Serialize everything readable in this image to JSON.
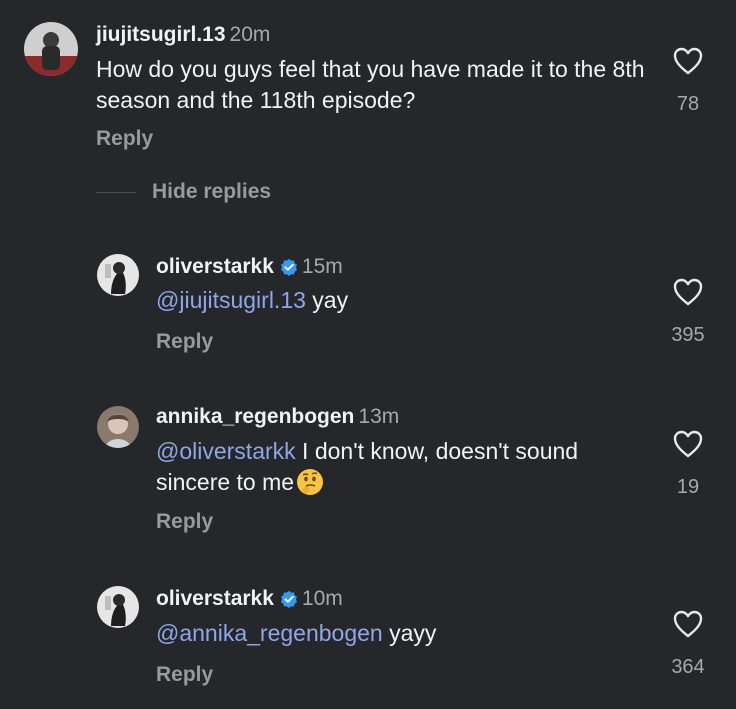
{
  "comments": [
    {
      "username": "jiujitsugirl.13",
      "time": "20m",
      "text": "How do you guys feel that you  have made it to the 8th season and the 118th episode?",
      "reply_label": "Reply",
      "likes": "78"
    }
  ],
  "hide_replies_label": "Hide replies",
  "replies": [
    {
      "username": "oliverstarkk",
      "verified": true,
      "time": "15m",
      "mention": "@jiujitsugirl.13",
      "text": " yay",
      "reply_label": "Reply",
      "likes": "395"
    },
    {
      "username": "annika_regenbogen",
      "verified": false,
      "time": "13m",
      "mention": "@oliverstarkk",
      "text": " I don't know, doesn't sound sincere to me",
      "emoji": "thinking-face-emoji",
      "reply_label": "Reply",
      "likes": "19"
    },
    {
      "username": "oliverstarkk",
      "verified": true,
      "time": "10m",
      "mention": "@annika_regenbogen",
      "text": " yayy",
      "reply_label": "Reply",
      "likes": "364"
    }
  ],
  "colors": {
    "background": "#25272b",
    "mention": "#8ea7e6",
    "verified": "#3897f0",
    "secondary_text": "#a8a8a8"
  }
}
